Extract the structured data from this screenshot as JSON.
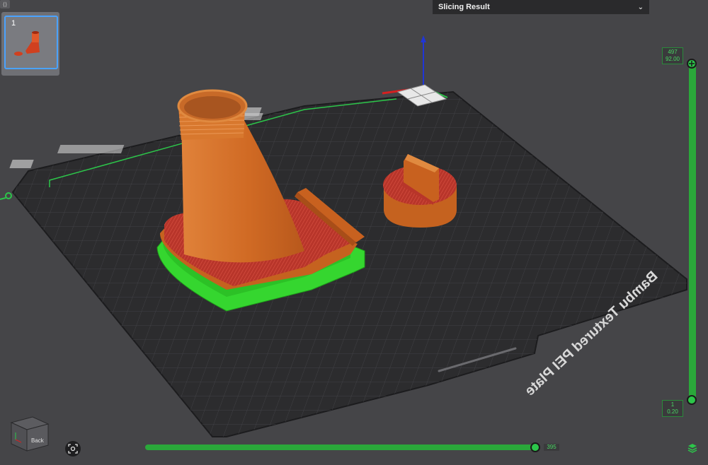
{
  "panel": {
    "title": "Slicing Result"
  },
  "plate_thumbnail": {
    "number": "1"
  },
  "bed": {
    "label": "Bambu Textured PEI Plate"
  },
  "layer_slider": {
    "top_layer": "497",
    "top_height": "92.00",
    "bottom_layer": "1",
    "bottom_height": "0.20"
  },
  "move_slider": {
    "value": "395"
  },
  "view_cube": {
    "face_label": "Back"
  },
  "colors": {
    "accent_green": "#2cc64a",
    "model_orange": "#d9752a",
    "model_top_red": "#c0392b",
    "support_green": "#35d62f",
    "bed": "#2c2c2e"
  },
  "icons": [
    "collapse-icon",
    "chevron-down-icon",
    "recenter-icon",
    "layers-icon",
    "view-cube-icon"
  ]
}
